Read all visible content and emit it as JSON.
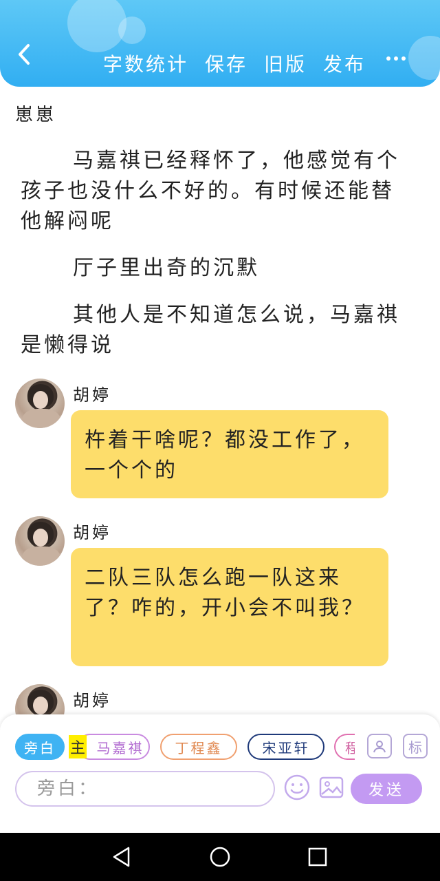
{
  "header": {
    "back_icon": "chevron-left-icon",
    "actions": [
      "字数统计",
      "保存",
      "旧版",
      "发布"
    ],
    "more_icon": "more-dots-icon"
  },
  "content": {
    "author": "崽崽",
    "paragraphs": [
      "马嘉祺已经释怀了，他感觉有个孩子也没什么不好的。有时候还能替他解闷呢",
      "厅子里出奇的沉默",
      "其他人是不知道怎么说，马嘉祺是懒得说"
    ],
    "messages": [
      {
        "name": "胡婷",
        "text": "杵着干啥呢？都没工作了，一个个的"
      },
      {
        "name": "胡婷",
        "text": "二队三队怎么跑一队这来了？咋的，开小会不叫我？"
      },
      {
        "name": "胡婷",
        "text": ""
      }
    ]
  },
  "composer": {
    "chips": [
      {
        "label": "旁白",
        "color": "#3fb3f3",
        "active": true
      },
      {
        "label": "马嘉祺",
        "color": "#c98be0",
        "active": false
      },
      {
        "label": "丁程鑫",
        "color": "#f0a070",
        "active": false
      },
      {
        "label": "宋亚轩",
        "color": "#1f3a7a",
        "active": false
      },
      {
        "label": "程",
        "color": "#e070b0",
        "active": false
      }
    ],
    "main_badge": "主",
    "role_icon": "user-card-icon",
    "tag_label": "标",
    "input_placeholder": "旁白：",
    "emoji_icon": "smiley-icon",
    "image_icon": "image-icon",
    "send_label": "发送"
  },
  "system_nav": {
    "back": "triangle-back-icon",
    "home": "circle-home-icon",
    "recents": "square-recents-icon"
  }
}
